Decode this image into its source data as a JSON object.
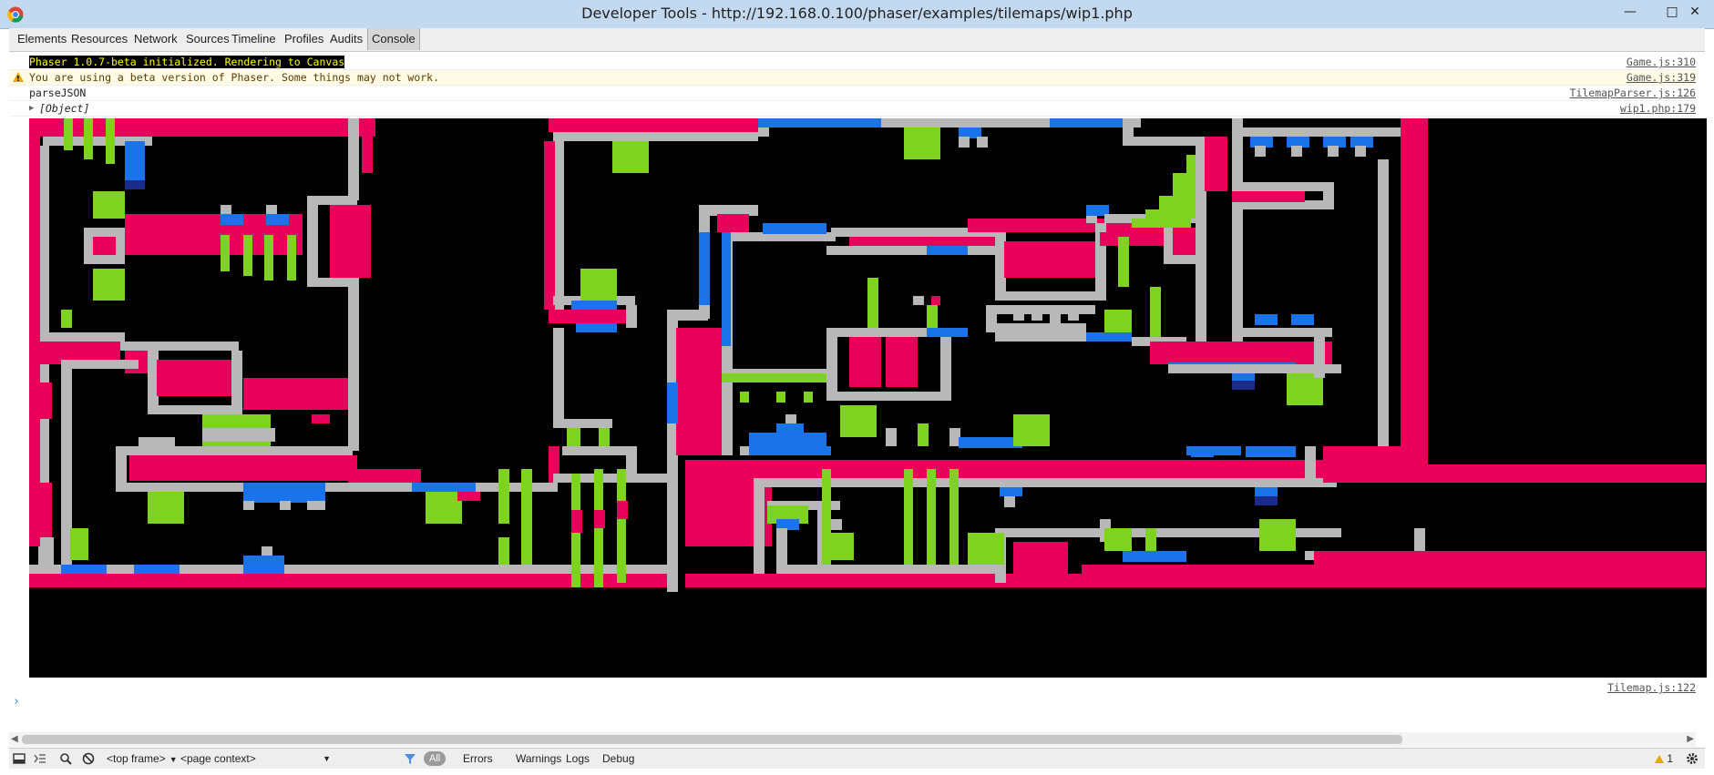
{
  "window": {
    "title": "Developer Tools - http://192.168.0.100/phaser/examples/tilemaps/wip1.php",
    "minimize": "—",
    "maximize": "□",
    "close": "✕"
  },
  "tabs": [
    "Elements",
    "Resources",
    "Network",
    "Sources",
    "Timeline",
    "Profiles",
    "Audits",
    "Console"
  ],
  "selected_tab": "Console",
  "console": {
    "messages": [
      {
        "text": "Phaser 1.0.7-beta initialized. Rendering to Canvas",
        "source": "Game.js:310",
        "level": "log"
      },
      {
        "text": "You are using a beta version of Phaser. Some things may not work.",
        "source": "Game.js:319",
        "level": "warning"
      },
      {
        "text": "parseJSON",
        "source": "TilemapParser.js:126",
        "level": "log"
      },
      {
        "text": "[Object]",
        "source": "wip1.php:179",
        "level": "log"
      }
    ],
    "canvas_source": "Tilemap.js:122",
    "prompt": "›"
  },
  "statusbar": {
    "frame_select": "<top frame>",
    "context_select": "<page context>",
    "filters": [
      "All",
      "Errors",
      "Warnings",
      "Logs",
      "Debug"
    ],
    "active_filter": "All",
    "warning_count": "1"
  },
  "icons": {
    "browser": "chrome-logo-icon",
    "dock": "dock-icon",
    "drawer": "console-drawer-icon",
    "search": "search-icon",
    "clear": "clear-console-icon",
    "filter": "filter-icon",
    "warning": "warning-icon",
    "settings": "gear-icon"
  },
  "colors": {
    "titlebar": "#c3d9ef",
    "tile_wall": "#b8b8b8",
    "tile_brick": "#e8005a",
    "tile_water": "#1a73e8",
    "tile_grass": "#7ed321",
    "tile_deep": "#1c2a8a"
  }
}
